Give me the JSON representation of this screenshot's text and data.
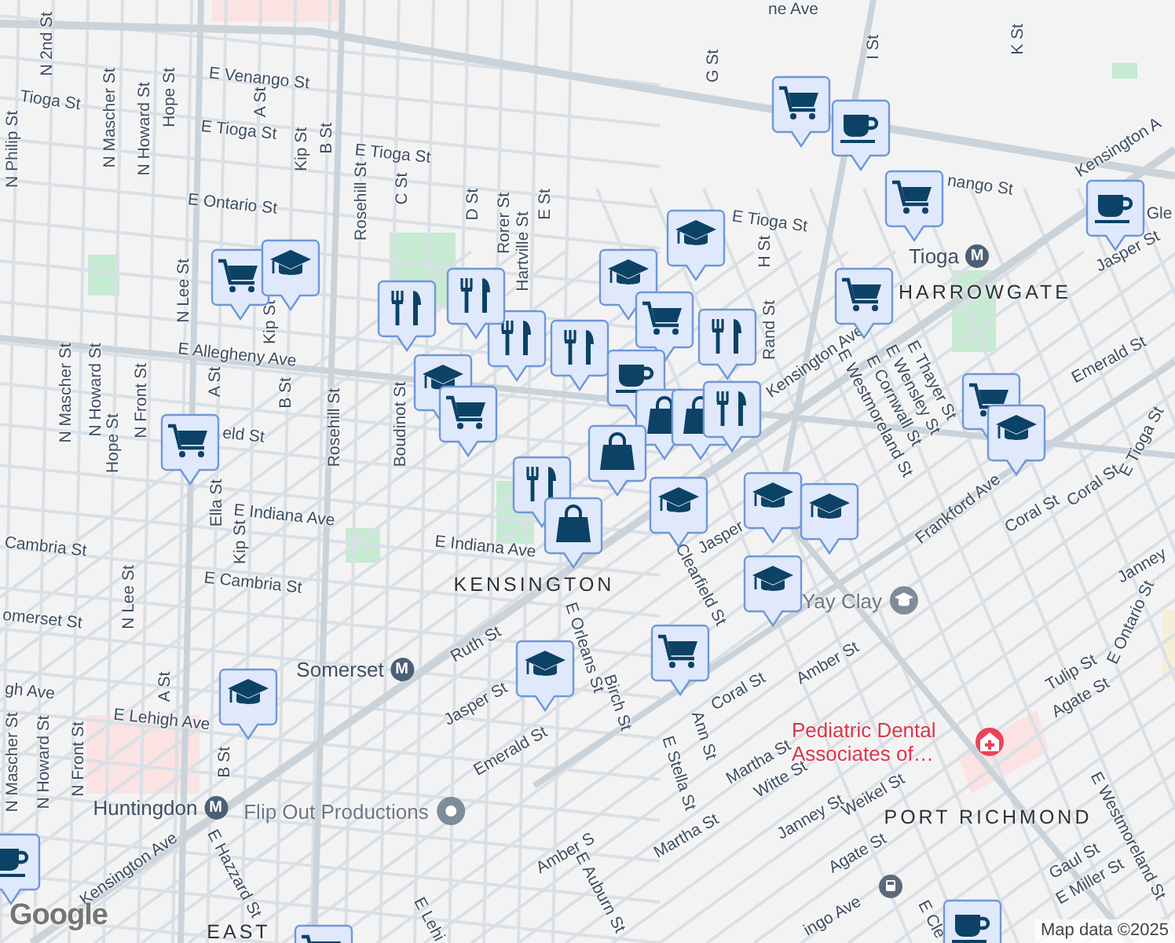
{
  "labels": [
    {
      "kind": "street",
      "text": "N 2nd St"
    },
    {
      "kind": "street",
      "text": "Tioga St"
    },
    {
      "kind": "street",
      "text": "N Philip St"
    },
    {
      "kind": "street",
      "text": "N Mascher St"
    },
    {
      "kind": "street",
      "text": "N Howard St"
    },
    {
      "kind": "street",
      "text": "Hope St"
    },
    {
      "kind": "street",
      "text": "E Venango St"
    },
    {
      "kind": "street",
      "text": "E Tioga St"
    },
    {
      "kind": "street",
      "text": "A St"
    },
    {
      "kind": "street",
      "text": "Kip St"
    },
    {
      "kind": "street",
      "text": "B St"
    },
    {
      "kind": "street",
      "text": "E Tioga St"
    },
    {
      "kind": "street",
      "text": "Rosehill St"
    },
    {
      "kind": "street",
      "text": "C St"
    },
    {
      "kind": "street",
      "text": "D St"
    },
    {
      "kind": "street",
      "text": "Rorer St"
    },
    {
      "kind": "street",
      "text": "Hartville St"
    },
    {
      "kind": "street",
      "text": "E St"
    },
    {
      "kind": "street",
      "text": "E Ontario St"
    },
    {
      "kind": "street",
      "text": "N Lee St"
    },
    {
      "kind": "street",
      "text": "Kip St"
    },
    {
      "kind": "street",
      "text": "E Allegheny Ave"
    },
    {
      "kind": "street",
      "text": "N Mascher St"
    },
    {
      "kind": "street",
      "text": "N Howard St"
    },
    {
      "kind": "street",
      "text": "Hope St"
    },
    {
      "kind": "street",
      "text": "N Front St"
    },
    {
      "kind": "street",
      "text": "A St"
    },
    {
      "kind": "street",
      "text": "B St"
    },
    {
      "kind": "street",
      "text": "Rosehill St"
    },
    {
      "kind": "street",
      "text": "Boudinot St"
    },
    {
      "kind": "street",
      "text": "eld St"
    },
    {
      "kind": "street",
      "text": "G St"
    },
    {
      "kind": "street",
      "text": "I St"
    },
    {
      "kind": "street",
      "text": "K St"
    },
    {
      "kind": "street",
      "text": "nango St"
    },
    {
      "kind": "street",
      "text": "Kensington A"
    },
    {
      "kind": "street",
      "text": "Gle"
    },
    {
      "kind": "street",
      "text": "E Tioga St"
    },
    {
      "kind": "street",
      "text": "H St"
    },
    {
      "kind": "street",
      "text": "Rand St"
    },
    {
      "kind": "street",
      "text": "Jasper St"
    },
    {
      "kind": "street",
      "text": "Emerald St"
    },
    {
      "kind": "street",
      "text": "Kensington Ave"
    },
    {
      "kind": "street",
      "text": "E Thayer St"
    },
    {
      "kind": "street",
      "text": "E Wensley St"
    },
    {
      "kind": "street",
      "text": "E Cornwall St"
    },
    {
      "kind": "street",
      "text": "E Westmoreland St"
    },
    {
      "kind": "street",
      "text": "Frankford Ave"
    },
    {
      "kind": "street",
      "text": "Coral St"
    },
    {
      "kind": "street",
      "text": "Coral St"
    },
    {
      "kind": "street",
      "text": "E Tioga St"
    },
    {
      "kind": "street",
      "text": "Janney"
    },
    {
      "kind": "street",
      "text": "E Ontario St"
    },
    {
      "kind": "street",
      "text": "Tulip St"
    },
    {
      "kind": "street",
      "text": "Agate St"
    },
    {
      "kind": "street",
      "text": "Jasper"
    },
    {
      "kind": "street",
      "text": "Clearfield St"
    },
    {
      "kind": "street",
      "text": "Amber St"
    },
    {
      "kind": "street",
      "text": "Coral St"
    },
    {
      "kind": "street",
      "text": "Ann St"
    },
    {
      "kind": "street",
      "text": "E Stella St"
    },
    {
      "kind": "street",
      "text": "Martha St"
    },
    {
      "kind": "street",
      "text": "Martha St"
    },
    {
      "kind": "street",
      "text": "Witte St"
    },
    {
      "kind": "street",
      "text": "Janney St"
    },
    {
      "kind": "street",
      "text": "Weikel St"
    },
    {
      "kind": "area",
      "text": "PORT RICHMOND"
    },
    {
      "kind": "street",
      "text": "Agate St"
    },
    {
      "kind": "street",
      "text": "Gaul St"
    },
    {
      "kind": "street",
      "text": "E Miller St"
    },
    {
      "kind": "street",
      "text": "E Westmoreland St"
    },
    {
      "kind": "street",
      "text": "E Indiana Ave"
    },
    {
      "kind": "street",
      "text": "E Indiana Ave"
    },
    {
      "kind": "street",
      "text": "Cambria St"
    },
    {
      "kind": "street",
      "text": "E Cambria St"
    },
    {
      "kind": "street",
      "text": "Ella St"
    },
    {
      "kind": "street",
      "text": "Kip St"
    },
    {
      "kind": "street",
      "text": "omerset St"
    },
    {
      "kind": "street",
      "text": "N Lee St"
    },
    {
      "kind": "street",
      "text": "A St"
    },
    {
      "kind": "street",
      "text": "Ruth St"
    },
    {
      "kind": "street",
      "text": "E Orleans St"
    },
    {
      "kind": "street",
      "text": "Birch St"
    },
    {
      "kind": "street",
      "text": "Jasper St"
    },
    {
      "kind": "street",
      "text": "Emerald St"
    },
    {
      "kind": "street",
      "text": "gh Ave"
    },
    {
      "kind": "street",
      "text": "E Lehigh Ave"
    },
    {
      "kind": "street",
      "text": "N Mascher St"
    },
    {
      "kind": "street",
      "text": "N Howard St"
    },
    {
      "kind": "street",
      "text": "N Front St"
    },
    {
      "kind": "street",
      "text": "B St"
    },
    {
      "kind": "street",
      "text": "Kensington Ave"
    },
    {
      "kind": "street",
      "text": "E Hazzard St"
    },
    {
      "kind": "street",
      "text": "E Lehi"
    },
    {
      "kind": "area",
      "text": "EAST"
    },
    {
      "kind": "street",
      "text": "Amber S"
    },
    {
      "kind": "street",
      "text": "E Auburn St"
    },
    {
      "kind": "street",
      "text": "E Cle"
    },
    {
      "kind": "street",
      "text": "ingo Ave"
    },
    {
      "kind": "street",
      "text": "ne Ave"
    },
    {
      "kind": "area",
      "text": "HARROWGATE"
    },
    {
      "kind": "area",
      "text": "KENSINGTON"
    },
    {
      "kind": "station",
      "text": "Tioga",
      "badge": "M"
    },
    {
      "kind": "station",
      "text": "Somerset",
      "badge": "M"
    },
    {
      "kind": "station",
      "text": "Huntingdon",
      "badge": "M"
    },
    {
      "kind": "poi_place",
      "text": "Flip Out Productions"
    },
    {
      "kind": "poi_school",
      "text": "Yay Clay"
    },
    {
      "kind": "poi_hospital",
      "text": "Pediatric Dental Associates of…"
    }
  ],
  "markers": [
    {
      "kind": "cart"
    },
    {
      "kind": "school"
    },
    {
      "kind": "cart"
    },
    {
      "kind": "cart"
    },
    {
      "kind": "coffee"
    },
    {
      "kind": "cart"
    },
    {
      "kind": "coffee"
    },
    {
      "kind": "school"
    },
    {
      "kind": "school"
    },
    {
      "kind": "cart"
    },
    {
      "kind": "cart"
    },
    {
      "kind": "restaurant"
    },
    {
      "kind": "restaurant"
    },
    {
      "kind": "restaurant"
    },
    {
      "kind": "restaurant"
    },
    {
      "kind": "school"
    },
    {
      "kind": "cart"
    },
    {
      "kind": "coffee"
    },
    {
      "kind": "restaurant"
    },
    {
      "kind": "cart"
    },
    {
      "kind": "school"
    },
    {
      "kind": "bag"
    },
    {
      "kind": "bag"
    },
    {
      "kind": "restaurant"
    },
    {
      "kind": "bag"
    },
    {
      "kind": "restaurant"
    },
    {
      "kind": "bag"
    },
    {
      "kind": "school"
    },
    {
      "kind": "school"
    },
    {
      "kind": "school"
    },
    {
      "kind": "school"
    },
    {
      "kind": "cart"
    },
    {
      "kind": "school"
    },
    {
      "kind": "school"
    },
    {
      "kind": "coffee"
    },
    {
      "kind": "coffee"
    },
    {
      "kind": "cart"
    }
  ],
  "logo": "Google",
  "attribution": "Map data ©2025"
}
